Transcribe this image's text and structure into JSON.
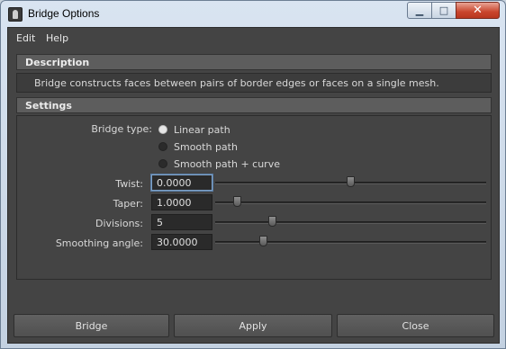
{
  "window": {
    "title": "Bridge Options",
    "controls": {
      "minimize": "▁",
      "maximize": "□",
      "close": "✕"
    }
  },
  "menubar": {
    "items": [
      "Edit",
      "Help"
    ]
  },
  "description": {
    "header": "Description",
    "text": "Bridge constructs faces between pairs of border edges or faces on a single mesh."
  },
  "settings": {
    "header": "Settings",
    "bridge_type": {
      "label": "Bridge type:",
      "options": [
        "Linear path",
        "Smooth path",
        "Smooth path + curve"
      ],
      "selected": "Linear path"
    },
    "twist": {
      "label": "Twist:",
      "value": "0.0000"
    },
    "taper": {
      "label": "Taper:",
      "value": "1.0000"
    },
    "divisions": {
      "label": "Divisions:",
      "value": "5"
    },
    "smoothing_angle": {
      "label": "Smoothing angle:",
      "value": "30.0000"
    }
  },
  "footer": {
    "bridge": "Bridge",
    "apply": "Apply",
    "close": "Close"
  }
}
